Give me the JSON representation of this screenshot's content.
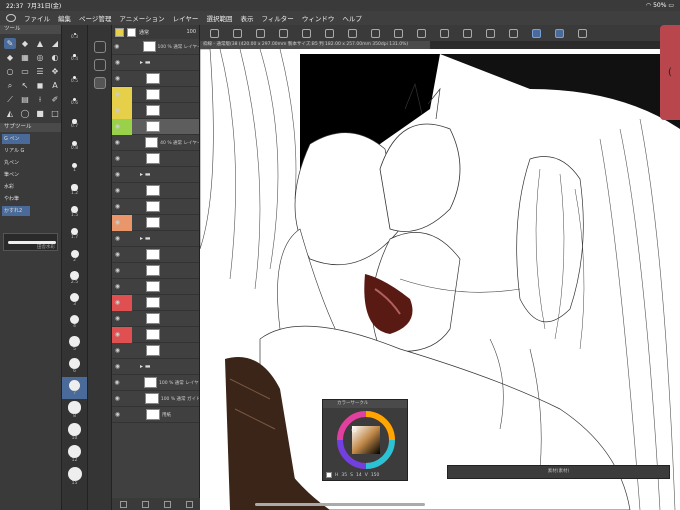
{
  "status": {
    "time": "22:37",
    "date": "7月31日(金)",
    "wifi": "wifi",
    "battery": "50%"
  },
  "menu": [
    "ファイル",
    "編集",
    "ページ管理",
    "アニメーション",
    "レイヤー",
    "選択範囲",
    "表示",
    "フィルター",
    "ウィンドウ",
    "ヘルプ"
  ],
  "info": "枠線 - 通常版(38 (420.00 x 297.00mm 製本サイズ:B5 判 182.00 x 257.00mm 350dpi 131.0%)",
  "toolpanel": {
    "head1": "ツール",
    "head2": "サブツール",
    "subtools": [
      "G ペン",
      "リアル G",
      "丸ペン",
      "筆ペン",
      "水彩",
      "やわ筆",
      "かすれ2",
      ""
    ],
    "brush_label": "田舎水彩"
  },
  "sizes": [
    "0.3",
    "0.4",
    "0.5",
    "0.6",
    "0.7",
    "0.8",
    "1",
    "1.2",
    "1.5",
    "1.7",
    "2",
    "2.5",
    "3",
    "4",
    "5",
    "6",
    "7",
    "8",
    "10",
    "12",
    "15"
  ],
  "layers": {
    "opacity": "100",
    "blend": "通常",
    "rows": [
      {
        "name": "100 % 通常 レイヤー 3",
        "color": ""
      },
      {
        "name": "",
        "color": "",
        "folder": true
      },
      {
        "name": "",
        "color": ""
      },
      {
        "name": "",
        "color": "yellow"
      },
      {
        "name": "",
        "color": "yellow"
      },
      {
        "name": "",
        "color": "green",
        "sel": true
      },
      {
        "name": "40 % 通常 レイヤー",
        "color": ""
      },
      {
        "name": "",
        "color": ""
      },
      {
        "name": "",
        "color": "",
        "folder": true
      },
      {
        "name": "",
        "color": ""
      },
      {
        "name": "",
        "color": ""
      },
      {
        "name": "",
        "color": "orange"
      },
      {
        "name": "",
        "color": "",
        "folder": true
      },
      {
        "name": "",
        "color": ""
      },
      {
        "name": "",
        "color": ""
      },
      {
        "name": "",
        "color": ""
      },
      {
        "name": "",
        "color": "red"
      },
      {
        "name": "",
        "color": ""
      },
      {
        "name": "",
        "color": "red"
      },
      {
        "name": "",
        "color": ""
      },
      {
        "name": "",
        "color": "",
        "folder": true
      },
      {
        "name": "100 % 通常 レイヤー",
        "color": ""
      },
      {
        "name": "100 % 通常 ガイド",
        "color": ""
      },
      {
        "name": "用紙",
        "color": ""
      }
    ]
  },
  "colorwheel": {
    "title": "カラーサークル",
    "h": "35",
    "s": "14",
    "v": "150"
  },
  "mini_panel": {
    "title": "素材(素材)"
  },
  "colors": {
    "accent": "#4a6b9a",
    "yellow": "#e6d04a",
    "green": "#9ad14a",
    "orange": "#e8966a",
    "red": "#e05050",
    "sidetab": "#b9454d"
  }
}
